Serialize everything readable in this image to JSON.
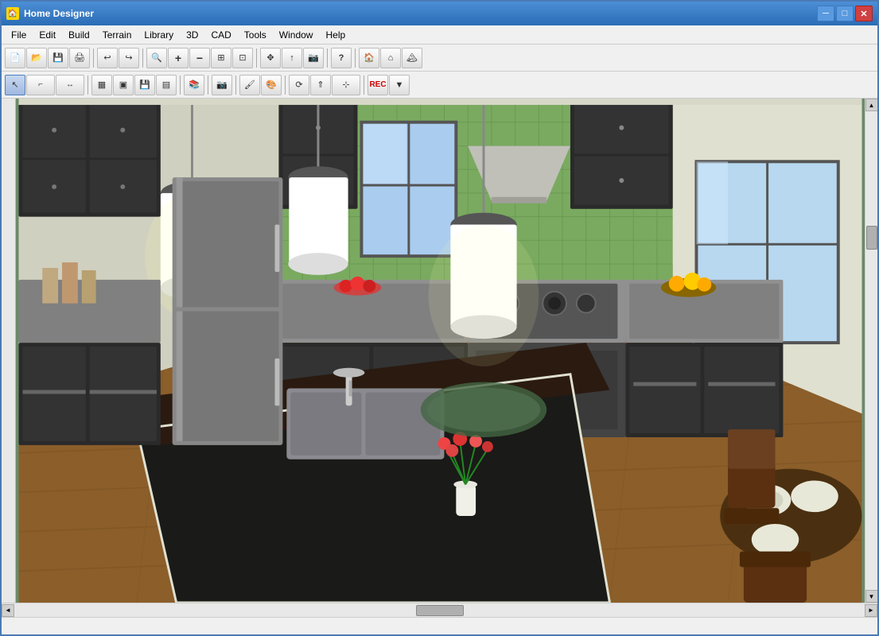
{
  "window": {
    "title": "Home Designer",
    "icon": "🏠"
  },
  "title_controls": {
    "minimize": "─",
    "maximize": "□",
    "close": "✕"
  },
  "menu": {
    "items": [
      "File",
      "Edit",
      "Build",
      "Terrain",
      "Library",
      "3D",
      "CAD",
      "Tools",
      "Window",
      "Help"
    ]
  },
  "toolbar1": {
    "buttons": [
      {
        "name": "new",
        "icon": "📄"
      },
      {
        "name": "open",
        "icon": "📂"
      },
      {
        "name": "save",
        "icon": "💾"
      },
      {
        "name": "print",
        "icon": "🖨"
      },
      {
        "name": "undo",
        "icon": "↩"
      },
      {
        "name": "redo",
        "icon": "↪"
      },
      {
        "name": "zoom-in-glass",
        "icon": "🔍"
      },
      {
        "name": "zoom-in",
        "icon": "+"
      },
      {
        "name": "zoom-out",
        "icon": "−"
      },
      {
        "name": "fit",
        "icon": "⊞"
      },
      {
        "name": "zoom-box",
        "icon": "⊡"
      },
      {
        "name": "move",
        "icon": "✥"
      },
      {
        "name": "arrow-up",
        "icon": "↑"
      },
      {
        "name": "camera",
        "icon": "📷"
      },
      {
        "name": "question",
        "icon": "?"
      },
      {
        "name": "house",
        "icon": "🏠"
      },
      {
        "name": "roof",
        "icon": "⌂"
      },
      {
        "name": "terrain-icon",
        "icon": "🏔"
      }
    ]
  },
  "toolbar2": {
    "buttons": [
      {
        "name": "select",
        "icon": "↖"
      },
      {
        "name": "polyline",
        "icon": "⌐"
      },
      {
        "name": "dimension",
        "icon": "↔"
      },
      {
        "name": "fill",
        "icon": "▦"
      },
      {
        "name": "cabinet",
        "icon": "▣"
      },
      {
        "name": "save2",
        "icon": "💾"
      },
      {
        "name": "stairs",
        "icon": "▤"
      },
      {
        "name": "library2",
        "icon": "📚"
      },
      {
        "name": "camera2",
        "icon": "📷"
      },
      {
        "name": "paint",
        "icon": "🖌"
      },
      {
        "name": "material",
        "icon": "🎨"
      },
      {
        "name": "transform",
        "icon": "⟳"
      },
      {
        "name": "arrow-group",
        "icon": "⇑"
      },
      {
        "name": "select2",
        "icon": "⊹"
      },
      {
        "name": "record",
        "icon": "⏺"
      }
    ]
  },
  "status": {
    "text": ""
  },
  "scrollbars": {
    "up_arrow": "▲",
    "down_arrow": "▼",
    "left_arrow": "◄",
    "right_arrow": "►"
  }
}
